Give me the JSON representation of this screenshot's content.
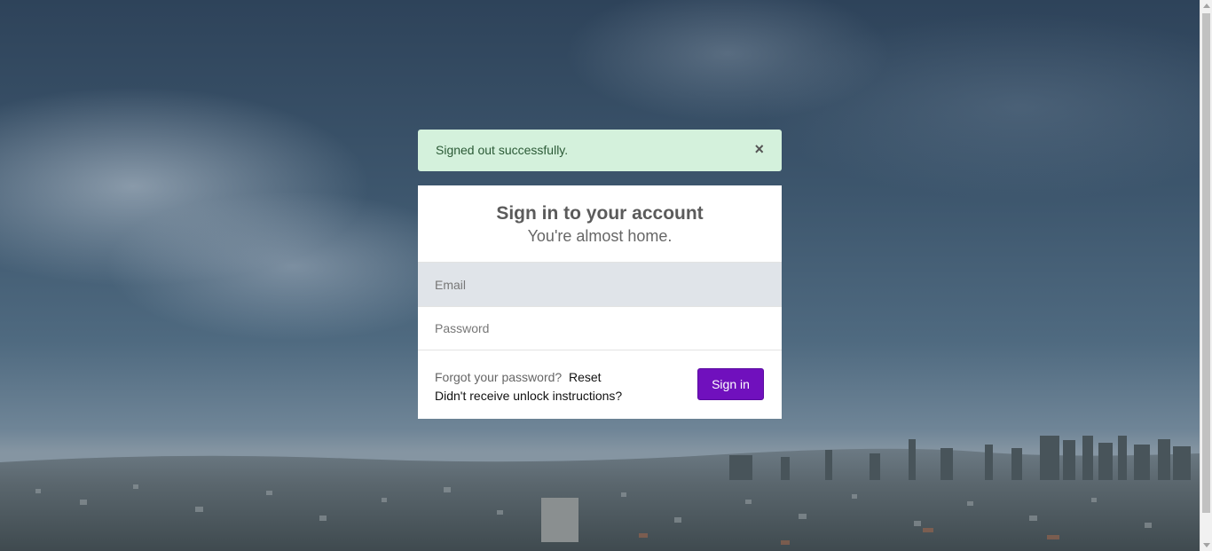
{
  "alert": {
    "message": "Signed out successfully.",
    "close_label": "×",
    "color": "#d4f1dc"
  },
  "login": {
    "title": "Sign in to your account",
    "subtitle": "You're almost home.",
    "email_placeholder": "Email",
    "password_placeholder": "Password",
    "forgot_text": "Forgot your password?",
    "reset_link": "Reset",
    "unlock_link": "Didn't receive unlock instructions?",
    "signin_label": "Sign in",
    "accent_color": "#7010bd"
  },
  "icons": {
    "close": "close-icon"
  }
}
